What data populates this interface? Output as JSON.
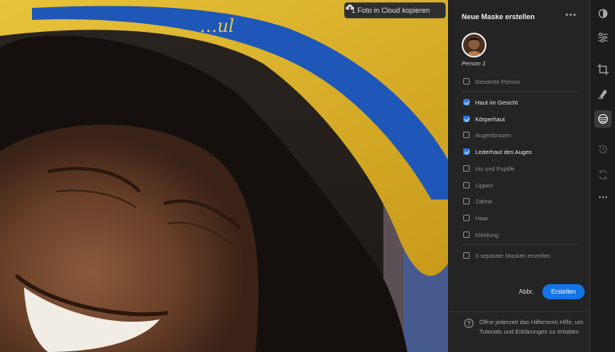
{
  "canvas": {
    "cloud_button_label": "1 Foto in Cloud kopieren",
    "cloud_icon": "cloud-upload-icon"
  },
  "panel": {
    "title": "Neue Maske erstellen",
    "more_icon": "more-horizontal-icon",
    "more_label": "•••",
    "person_label": "Person 1",
    "options": [
      {
        "label": "Gesamte Person",
        "checked": false
      },
      {
        "label": "Haut im Gesicht",
        "checked": true
      },
      {
        "label": "Körperhaut",
        "checked": true
      },
      {
        "label": "Augenbrauen",
        "checked": false
      },
      {
        "label": "Lederhaut des Auges",
        "checked": true
      },
      {
        "label": "Iris und Pupille",
        "checked": false
      },
      {
        "label": "Lippen",
        "checked": false
      },
      {
        "label": "Zähne",
        "checked": false
      },
      {
        "label": "Haar",
        "checked": false
      },
      {
        "label": "Kleidung",
        "checked": false
      }
    ],
    "separate_masks_label": "3 separate Masken erstellen",
    "cancel_label": "Abbr.",
    "create_label": "Erstellen",
    "help_text": "Öffne jederzeit das Hilfemenü Hilfe, um Tutorials und Erklärungen zu erhalten",
    "accent_color": "#1473e6"
  },
  "toolbar": {
    "tools": [
      "edit-icon",
      "sliders-icon",
      "crop-icon",
      "heal-icon",
      "masking-icon",
      "history-icon",
      "presets-icon",
      "more-icon"
    ],
    "active_tool": "masking-icon"
  }
}
